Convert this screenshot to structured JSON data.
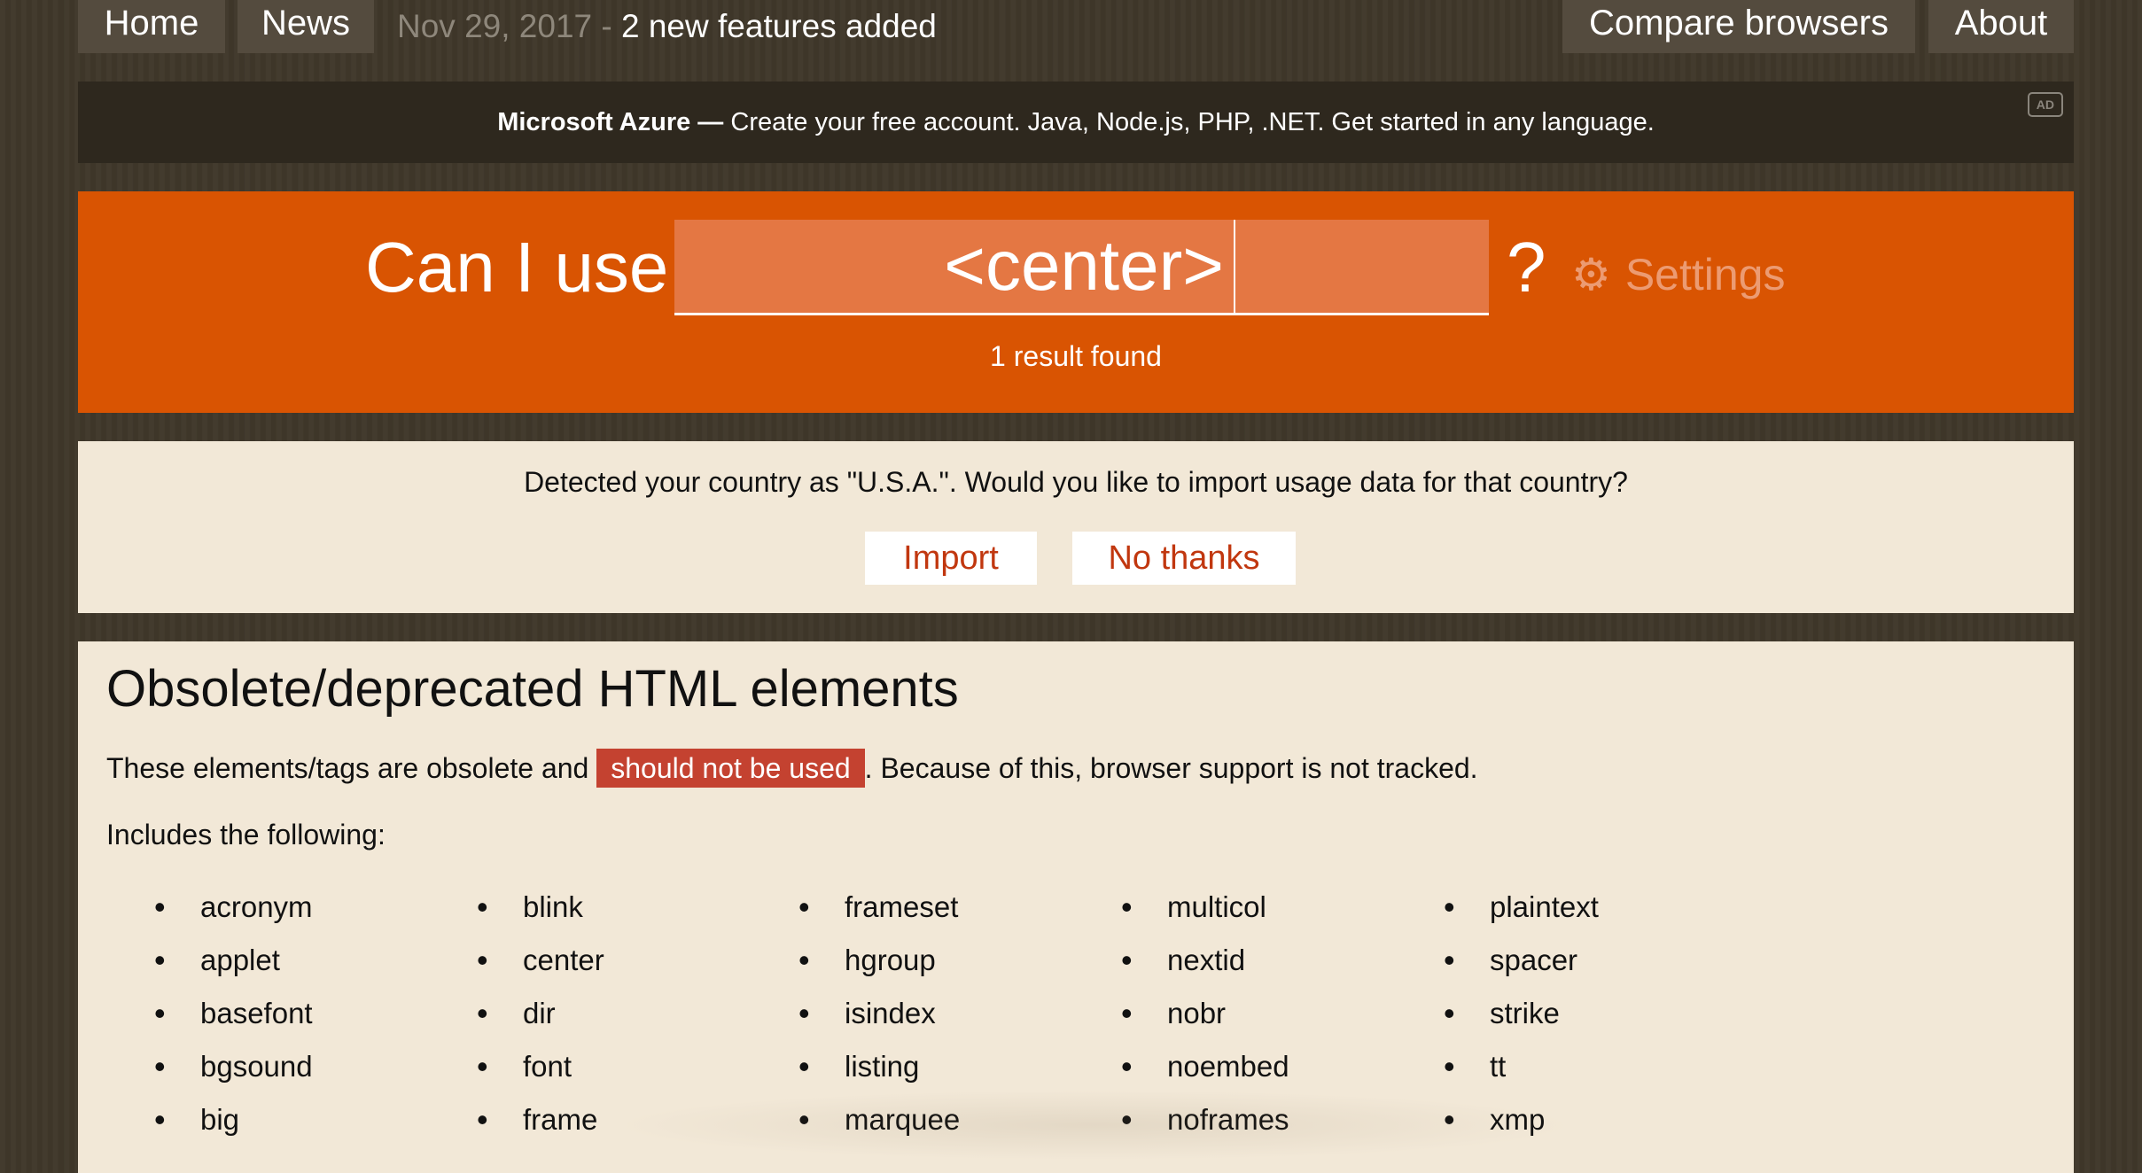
{
  "nav": {
    "home": "Home",
    "news": "News",
    "news_date": "Nov 29, 2017",
    "news_separator": " - ",
    "news_headline": "2 new features added",
    "compare": "Compare browsers",
    "about": "About"
  },
  "ad": {
    "brand": "Microsoft Azure",
    "dash": " — ",
    "text": "Create your free account. Java, Node.js, PHP, .NET. Get started in any language.",
    "badge": "AD"
  },
  "search": {
    "prefix": "Can I use",
    "query": "<center>",
    "suffix": "?",
    "settings_icon": "gear-icon",
    "settings_label": "Settings",
    "results": "1 result found"
  },
  "country_prompt": {
    "message": "Detected your country as \"U.S.A.\". Would you like to import usage data for that country?",
    "import_label": "Import",
    "decline_label": "No thanks"
  },
  "feature": {
    "title": "Obsolete/deprecated HTML elements",
    "desc_before": "These elements/tags are obsolete and ",
    "desc_highlight": "should not be used",
    "desc_after": ". Because of this, browser support is not tracked.",
    "includes_label": "Includes the following:",
    "columns": [
      [
        "acronym",
        "applet",
        "basefont",
        "bgsound",
        "big"
      ],
      [
        "blink",
        "center",
        "dir",
        "font",
        "frame"
      ],
      [
        "frameset",
        "hgroup",
        "isindex",
        "listing",
        "marquee"
      ],
      [
        "multicol",
        "nextid",
        "nobr",
        "noembed",
        "noframes"
      ],
      [
        "plaintext",
        "spacer",
        "strike",
        "tt",
        "xmp"
      ]
    ]
  },
  "colors": {
    "background": "#3f372a",
    "accent": "#d95402",
    "search_field": "#e47743",
    "panel": "#f2e8d7",
    "warning": "#c44230",
    "button_text": "#c1370f"
  }
}
